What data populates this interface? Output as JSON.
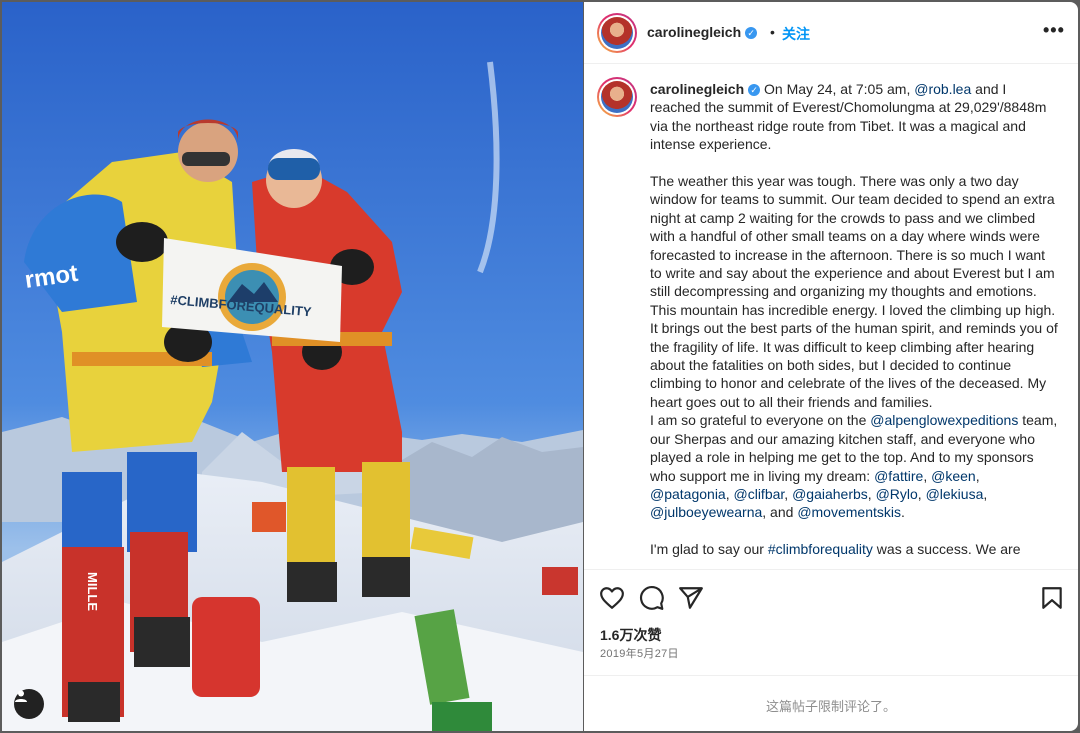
{
  "header": {
    "username": "carolinegleich",
    "separator": "•",
    "follow_label": "关注",
    "more_label": "•••"
  },
  "caption": {
    "username": "carolinegleich",
    "paragraph1_part1": "On May 24, at 7:05 am,",
    "mention_rob": "@rob.lea",
    "paragraph1_part2": "and I reached the summit of Everest/Chomolungma at 29,029'/8848m via the northeast ridge route from Tibet. It was a magical and intense experience.",
    "paragraph2": "The weather this year was tough. There was only a two day window for teams to summit. Our team decided to spend an extra night at camp 2 waiting for the crowds to pass and we climbed with a handful of other small teams on a day where winds were forecasted to increase in the afternoon. There is so much I want to write and say about the experience and about Everest but I am still decompressing and organizing my thoughts and emotions. This mountain has incredible energy. I loved the climbing up high. It brings out the best parts of the human spirit, and reminds you of the fragility of life. It was difficult to keep climbing after hearing about the fatalities on both sides, but I decided to continue climbing to honor and celebrate of the lives of the deceased. My heart goes out to all their friends and families.",
    "paragraph3_part1": "I am so grateful to everyone on the",
    "mention_alpenglow": "@alpenglowexpeditions",
    "paragraph3_part2": "team, our Sherpas and our amazing kitchen staff, and everyone who played a role in helping me get to the top. And to my sponsors who support me in living my dream:",
    "sponsors": [
      {
        "handle": "@fattire",
        "sep": ", "
      },
      {
        "handle": "@keen",
        "sep": ", "
      },
      {
        "handle": "@patagonia",
        "sep": ", "
      },
      {
        "handle": "@clifbar",
        "sep": ", "
      },
      {
        "handle": "@gaiaherbs",
        "sep": ", "
      },
      {
        "handle": "@Rylo",
        "sep": ", "
      },
      {
        "handle": "@lekiusa",
        "sep": ", "
      },
      {
        "handle": "@julboeyewearna",
        "sep": ", and "
      },
      {
        "handle": "@movementskis",
        "sep": "."
      }
    ],
    "paragraph4_part1": "I'm glad to say our",
    "hashtag": "#climbforequality",
    "paragraph4_part2": "was a success. We are"
  },
  "photo": {
    "banner_text": "#CLIMBFOREQUALITY",
    "jacket_brand": "rmot",
    "boot_brand": "MILLE"
  },
  "actions": {
    "like_icon": "heart-icon",
    "comment_icon": "comment-icon",
    "share_icon": "share-icon",
    "save_icon": "bookmark-icon",
    "likes": "1.6万次赞",
    "date": "2019年5月27日"
  },
  "footer": {
    "comments_limited": "这篇帖子限制评论了。"
  },
  "colors": {
    "link": "#00376b",
    "follow": "#0095f6",
    "verified": "#3897f0"
  }
}
